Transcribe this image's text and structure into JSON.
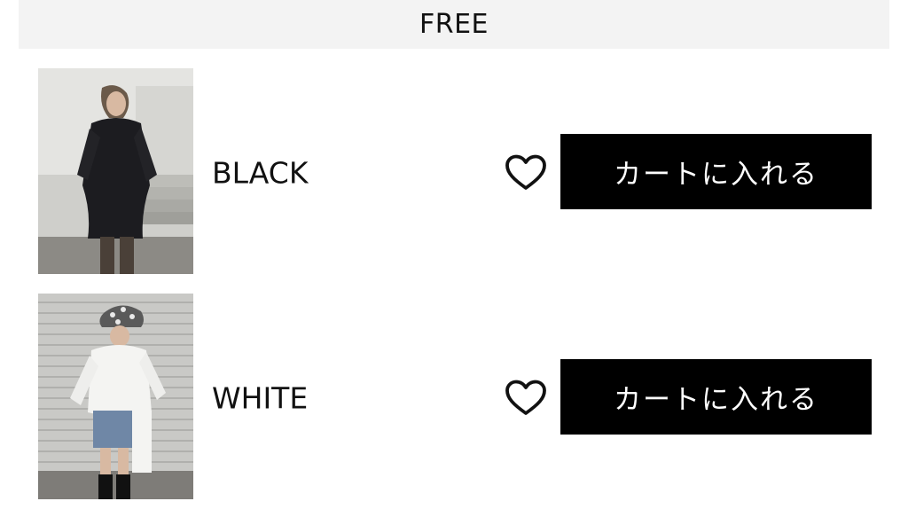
{
  "size_section": {
    "label": "FREE"
  },
  "variants": [
    {
      "color_name": "BLACK",
      "thumbnail_icon": "product-photo-black",
      "favorite_icon": "heart-outline-icon",
      "cart_label": "カートに入れる"
    },
    {
      "color_name": "WHITE",
      "thumbnail_icon": "product-photo-white",
      "favorite_icon": "heart-outline-icon",
      "cart_label": "カートに入れる"
    }
  ],
  "colors": {
    "header_bg": "#f3f3f3",
    "button_bg": "#000000",
    "button_text": "#ffffff",
    "text": "#111111"
  }
}
